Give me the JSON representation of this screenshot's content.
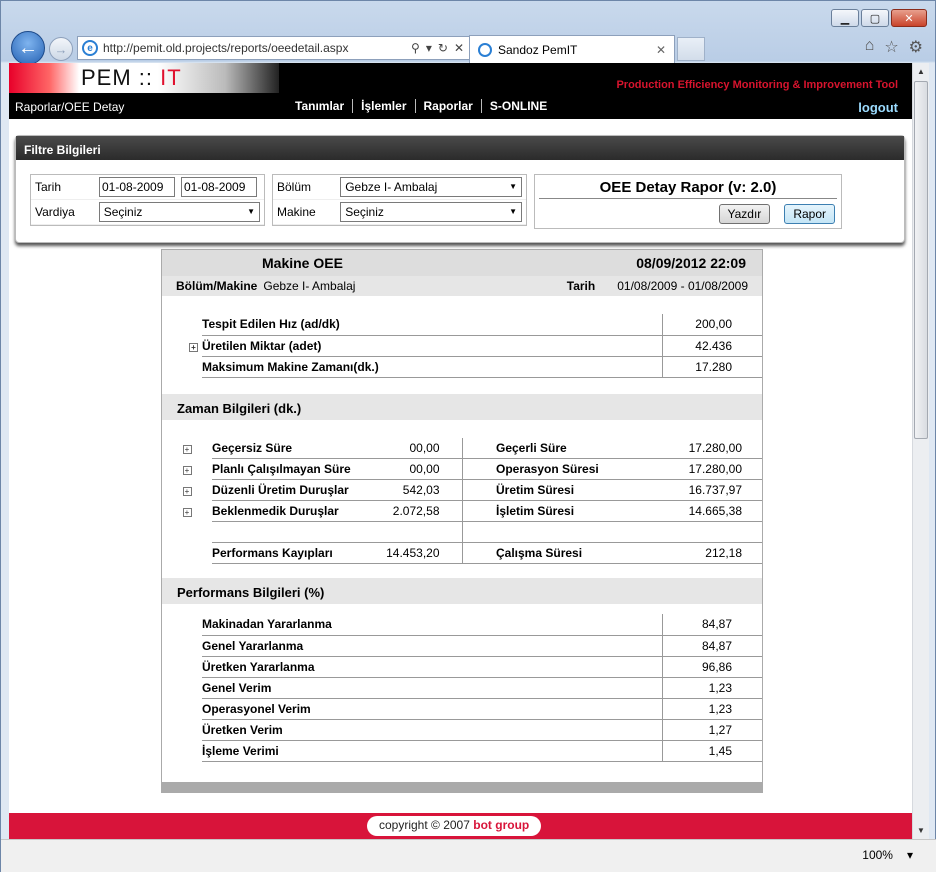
{
  "browser": {
    "url": "http://pemit.old.projects/reports/oeedetail.aspx",
    "tab_title": "Sandoz PemIT",
    "zoom": "100%"
  },
  "header": {
    "logo_left": "PEM",
    "logo_sep": " :: ",
    "logo_right": "IT",
    "tool_name": "Production Efficiency Monitoring & Improvement Tool",
    "breadcrumb": "Raporlar/OEE Detay",
    "menu": [
      "Tanımlar",
      "İşlemler",
      "Raporlar",
      "S-ONLINE"
    ],
    "logout": "logout"
  },
  "filter": {
    "title": "Filtre Bilgileri",
    "tarih_label": "Tarih",
    "date_from": "01-08-2009",
    "date_to": "01-08-2009",
    "vardiya_label": "Vardiya",
    "vardiya_value": "Seçiniz",
    "bolum_label": "Bölüm",
    "bolum_value": "Gebze I- Ambalaj",
    "makine_label": "Makine",
    "makine_value": "Seçiniz",
    "report_title": "OEE Detay Rapor (v: 2.0)",
    "print_button": "Yazdır",
    "report_button": "Rapor"
  },
  "report": {
    "title": "Makine OEE",
    "datetime": "08/09/2012 22:09",
    "bolum_makine_label": "Bölüm/Makine",
    "bolum_makine_value": "Gebze I- Ambalaj",
    "tarih_label": "Tarih",
    "tarih_value": "01/08/2009 - 01/08/2009",
    "top_rows": [
      {
        "label": "Tespit Edilen Hız (ad/dk)",
        "value": "200,00"
      },
      {
        "label": "Üretilen Miktar (adet)",
        "value": "42.436"
      },
      {
        "label": "Maksimum Makine Zamanı(dk.)",
        "value": "17.280"
      }
    ],
    "zaman_title": "Zaman Bilgileri (dk.)",
    "zaman_rows": [
      {
        "left_label": "Geçersiz Süre",
        "left_value": "00,00",
        "right_label": "Geçerli Süre",
        "right_value": "17.280,00"
      },
      {
        "left_label": "Planlı Çalışılmayan Süre",
        "left_value": "00,00",
        "right_label": "Operasyon Süresi",
        "right_value": "17.280,00"
      },
      {
        "left_label": "Düzenli Üretim Duruşlar",
        "left_value": "542,03",
        "right_label": "Üretim Süresi",
        "right_value": "16.737,97"
      },
      {
        "left_label": "Beklenmedik Duruşlar",
        "left_value": "2.072,58",
        "right_label": "İşletim Süresi",
        "right_value": "14.665,38"
      }
    ],
    "perf_kayip_label": "Performans Kayıpları",
    "perf_kayip_value": "14.453,20",
    "calisma_label": "Çalışma Süresi",
    "calisma_value": "212,18",
    "performans_title": "Performans Bilgileri (%)",
    "perf_rows": [
      {
        "label": "Makinadan Yararlanma",
        "value": "84,87"
      },
      {
        "label": "Genel Yararlanma",
        "value": "84,87"
      },
      {
        "label": "Üretken Yararlanma",
        "value": "96,86"
      },
      {
        "label": "Genel Verim",
        "value": "1,23"
      },
      {
        "label": "Operasyonel Verim",
        "value": "1,23"
      },
      {
        "label": "Üretken Verim",
        "value": "1,27"
      },
      {
        "label": "İşleme Verimi",
        "value": "1,45"
      }
    ]
  },
  "footer": {
    "copyright": "copyright © 2007",
    "company": "bot group"
  }
}
